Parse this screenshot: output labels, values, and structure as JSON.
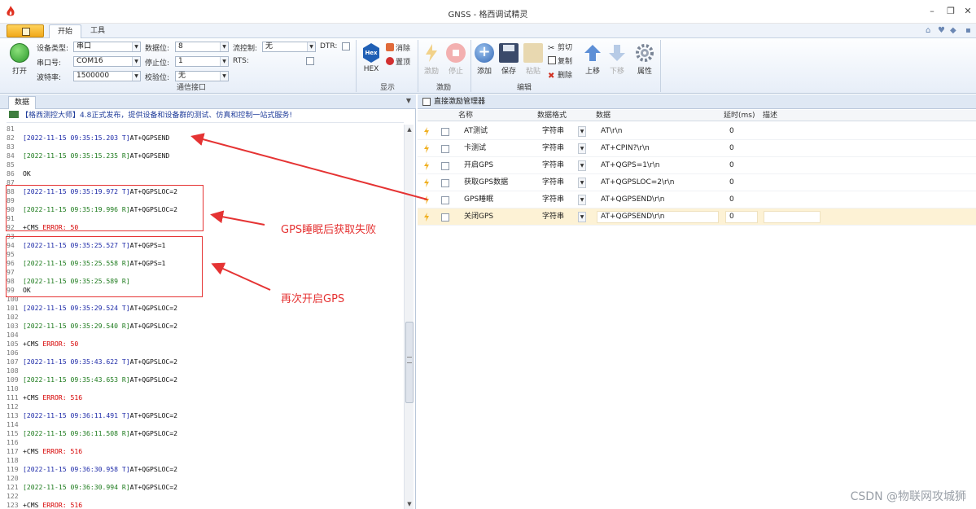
{
  "window": {
    "title": "GNSS - 格西调试精灵"
  },
  "tabs": {
    "start": "开始",
    "tools": "工具"
  },
  "ribbon": {
    "open_label": "打开",
    "fields": {
      "device_type_label": "设备类型:",
      "device_type_value": "串口",
      "port_label": "串口号:",
      "port_value": "COM16",
      "baud_label": "波特率:",
      "baud_value": "1500000",
      "databits_label": "数据位:",
      "databits_value": "8",
      "stopbits_label": "停止位:",
      "stopbits_value": "1",
      "parity_label": "校验位:",
      "parity_value": "无",
      "flow_label": "流控制:",
      "flow_value": "无",
      "dtr_label": "DTR:",
      "rts_label": "RTS:"
    },
    "group_comm": "通信接口",
    "hex_label": "HEX",
    "clear_label": "消除",
    "pin_label": "置顶",
    "group_display": "显示",
    "excite_label": "激励",
    "stop_label": "停止",
    "group_excite": "激励",
    "add_label": "添加",
    "save_label": "保存",
    "paste_label": "粘贴",
    "cut_label": "剪切",
    "copy_label": "复制",
    "delete_label": "删除",
    "up_label": "上移",
    "down_label": "下移",
    "props_label": "属性",
    "group_edit": "编辑"
  },
  "left_panel": {
    "tab": "数据",
    "notice": "【格西测控大师】4.8正式发布，提供设备和设备群的测试、仿真和控制一站式服务!"
  },
  "log_lines": [
    {
      "n": "81",
      "ts": "",
      "dir": "",
      "cmd": "",
      "kind": "blank"
    },
    {
      "n": "82",
      "ts": "[2022-11-15 09:35:15.203 T]",
      "dir": "t",
      "cmd": "AT+QGPSEND",
      "kind": "ts"
    },
    {
      "n": "83",
      "ts": "",
      "dir": "",
      "cmd": "",
      "kind": "blank"
    },
    {
      "n": "84",
      "ts": "[2022-11-15 09:35:15.235 R]",
      "dir": "r",
      "cmd": "AT+QGPSEND",
      "kind": "ts"
    },
    {
      "n": "85",
      "ts": "",
      "dir": "",
      "cmd": "",
      "kind": "blank"
    },
    {
      "n": "86",
      "ts": "",
      "dir": "",
      "cmd": "OK",
      "kind": "text"
    },
    {
      "n": "87",
      "ts": "",
      "dir": "",
      "cmd": "",
      "kind": "blank"
    },
    {
      "n": "88",
      "ts": "[2022-11-15 09:35:19.972 T]",
      "dir": "t",
      "cmd": "AT+QGPSLOC=2",
      "kind": "ts"
    },
    {
      "n": "89",
      "ts": "",
      "dir": "",
      "cmd": "",
      "kind": "blank"
    },
    {
      "n": "90",
      "ts": "[2022-11-15 09:35:19.996 R]",
      "dir": "r",
      "cmd": "AT+QGPSLOC=2",
      "kind": "ts"
    },
    {
      "n": "91",
      "ts": "",
      "dir": "",
      "cmd": "",
      "kind": "blank"
    },
    {
      "n": "92",
      "ts": "",
      "dir": "",
      "cmd": "+CMS ",
      "err": "ERROR: 50",
      "kind": "err"
    },
    {
      "n": "93",
      "ts": "",
      "dir": "",
      "cmd": "",
      "kind": "blank"
    },
    {
      "n": "94",
      "ts": "[2022-11-15 09:35:25.527 T]",
      "dir": "t",
      "cmd": "AT+QGPS=1",
      "kind": "ts"
    },
    {
      "n": "95",
      "ts": "",
      "dir": "",
      "cmd": "",
      "kind": "blank"
    },
    {
      "n": "96",
      "ts": "[2022-11-15 09:35:25.558 R]",
      "dir": "r",
      "cmd": "AT+QGPS=1",
      "kind": "ts"
    },
    {
      "n": "97",
      "ts": "",
      "dir": "",
      "cmd": "",
      "kind": "blank"
    },
    {
      "n": "98",
      "ts": "[2022-11-15 09:35:25.589 R]",
      "dir": "r",
      "cmd": "",
      "kind": "ts"
    },
    {
      "n": "99",
      "ts": "",
      "dir": "",
      "cmd": "OK",
      "kind": "text"
    },
    {
      "n": "100",
      "ts": "",
      "dir": "",
      "cmd": "",
      "kind": "blank"
    },
    {
      "n": "101",
      "ts": "[2022-11-15 09:35:29.524 T]",
      "dir": "t",
      "cmd": "AT+QGPSLOC=2",
      "kind": "ts"
    },
    {
      "n": "102",
      "ts": "",
      "dir": "",
      "cmd": "",
      "kind": "blank"
    },
    {
      "n": "103",
      "ts": "[2022-11-15 09:35:29.540 R]",
      "dir": "r",
      "cmd": "AT+QGPSLOC=2",
      "kind": "ts"
    },
    {
      "n": "104",
      "ts": "",
      "dir": "",
      "cmd": "",
      "kind": "blank"
    },
    {
      "n": "105",
      "ts": "",
      "dir": "",
      "cmd": "+CMS ",
      "err": "ERROR: 50",
      "kind": "err"
    },
    {
      "n": "106",
      "ts": "",
      "dir": "",
      "cmd": "",
      "kind": "blank"
    },
    {
      "n": "107",
      "ts": "[2022-11-15 09:35:43.622 T]",
      "dir": "t",
      "cmd": "AT+QGPSLOC=2",
      "kind": "ts"
    },
    {
      "n": "108",
      "ts": "",
      "dir": "",
      "cmd": "",
      "kind": "blank"
    },
    {
      "n": "109",
      "ts": "[2022-11-15 09:35:43.653 R]",
      "dir": "r",
      "cmd": "AT+QGPSLOC=2",
      "kind": "ts"
    },
    {
      "n": "110",
      "ts": "",
      "dir": "",
      "cmd": "",
      "kind": "blank"
    },
    {
      "n": "111",
      "ts": "",
      "dir": "",
      "cmd": "+CMS ",
      "err": "ERROR: 516",
      "kind": "err"
    },
    {
      "n": "112",
      "ts": "",
      "dir": "",
      "cmd": "",
      "kind": "blank"
    },
    {
      "n": "113",
      "ts": "[2022-11-15 09:36:11.491 T]",
      "dir": "t",
      "cmd": "AT+QGPSLOC=2",
      "kind": "ts"
    },
    {
      "n": "114",
      "ts": "",
      "dir": "",
      "cmd": "",
      "kind": "blank"
    },
    {
      "n": "115",
      "ts": "[2022-11-15 09:36:11.508 R]",
      "dir": "r",
      "cmd": "AT+QGPSLOC=2",
      "kind": "ts"
    },
    {
      "n": "116",
      "ts": "",
      "dir": "",
      "cmd": "",
      "kind": "blank"
    },
    {
      "n": "117",
      "ts": "",
      "dir": "",
      "cmd": "+CMS ",
      "err": "ERROR: 516",
      "kind": "err"
    },
    {
      "n": "118",
      "ts": "",
      "dir": "",
      "cmd": "",
      "kind": "blank"
    },
    {
      "n": "119",
      "ts": "[2022-11-15 09:36:30.958 T]",
      "dir": "t",
      "cmd": "AT+QGPSLOC=2",
      "kind": "ts"
    },
    {
      "n": "120",
      "ts": "",
      "dir": "",
      "cmd": "",
      "kind": "blank"
    },
    {
      "n": "121",
      "ts": "[2022-11-15 09:36:30.994 R]",
      "dir": "r",
      "cmd": "AT+QGPSLOC=2",
      "kind": "ts"
    },
    {
      "n": "122",
      "ts": "",
      "dir": "",
      "cmd": "",
      "kind": "blank"
    },
    {
      "n": "123",
      "ts": "",
      "dir": "",
      "cmd": "+CMS ",
      "err": "ERROR: 516",
      "kind": "err"
    }
  ],
  "right_panel": {
    "title": "直接激励管理器",
    "columns": {
      "name": "名称",
      "format": "数据格式",
      "data": "数据",
      "delay": "延时(ms)",
      "desc": "描述"
    },
    "rows": [
      {
        "name": "AT测试",
        "format": "字符串",
        "data": "AT\\r\\n",
        "delay": "0"
      },
      {
        "name": "卡测试",
        "format": "字符串",
        "data": "AT+CPIN?\\r\\n",
        "delay": "0"
      },
      {
        "name": "开启GPS",
        "format": "字符串",
        "data": "AT+QGPS=1\\r\\n",
        "delay": "0"
      },
      {
        "name": "获取GPS数据",
        "format": "字符串",
        "data": "AT+QGPSLOC=2\\r\\n",
        "delay": "0"
      },
      {
        "name": "GPS睡眠",
        "format": "字符串",
        "data": "AT+QGPSEND\\r\\n",
        "delay": "0"
      },
      {
        "name": "关闭GPS",
        "format": "字符串",
        "data": "AT+QGPSEND\\r\\n",
        "delay": "0"
      }
    ]
  },
  "annotations": {
    "fail_text": "GPS睡眠后获取失败",
    "restart_text": "再次开启GPS",
    "color": "#e53333"
  },
  "watermark": "CSDN @物联网攻城狮",
  "colors": {
    "tx_timestamp": "#1d2aa8",
    "rx_timestamp": "#1c7a1c",
    "error": "#d60000",
    "selected_row": "#fdf2d5"
  }
}
